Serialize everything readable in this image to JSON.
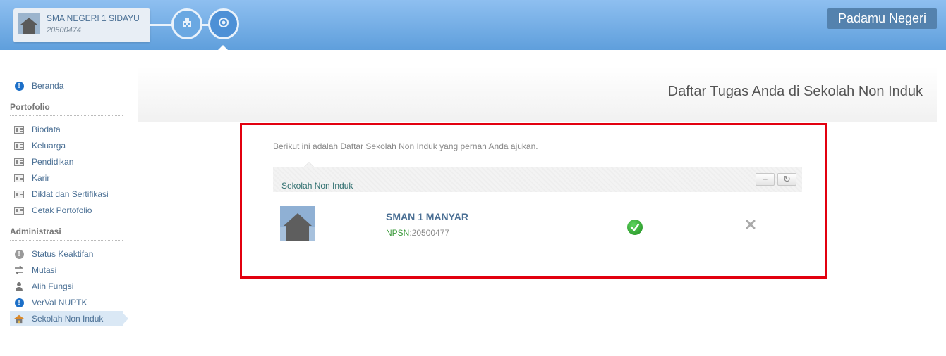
{
  "header": {
    "school_name": "SMA NEGERI 1 SIDAYU",
    "school_code": "20500474",
    "brand": "Padamu Negeri",
    "steps": [
      {
        "icon": "building-icon"
      },
      {
        "icon": "emblem-icon"
      }
    ]
  },
  "sidebar": {
    "beranda": {
      "label": "Beranda",
      "icon": "info-icon"
    },
    "portofolio_title": "Portofolio",
    "portofolio_items": [
      {
        "label": "Biodata",
        "icon": "id-card-icon"
      },
      {
        "label": "Keluarga",
        "icon": "id-card-icon"
      },
      {
        "label": "Pendidikan",
        "icon": "id-card-icon"
      },
      {
        "label": "Karir",
        "icon": "id-card-icon"
      },
      {
        "label": "Diklat dan Sertifikasi",
        "icon": "id-card-icon"
      },
      {
        "label": "Cetak Portofolio",
        "icon": "id-card-icon"
      }
    ],
    "administrasi_title": "Administrasi",
    "administrasi_items": [
      {
        "label": "Status Keaktifan",
        "icon": "info-grey-icon"
      },
      {
        "label": "Mutasi",
        "icon": "transfer-icon"
      },
      {
        "label": "Alih Fungsi",
        "icon": "person-icon"
      },
      {
        "label": "VerVal NUPTK",
        "icon": "info-icon"
      },
      {
        "label": "Sekolah Non Induk",
        "icon": "school-house-icon",
        "active": true
      }
    ]
  },
  "main": {
    "title": "Daftar Tugas Anda di Sekolah Non Induk",
    "intro": "Berikut ini adalah Daftar Sekolah Non Induk yang pernah Anda ajukan.",
    "list_title": "Sekolah Non Induk",
    "tools": {
      "add": "+",
      "refresh": "↻"
    },
    "rows": [
      {
        "name": "SMAN 1 MANYAR",
        "npsn_label": "NPSN",
        "npsn_value": ":20500477",
        "status": "approved"
      }
    ]
  },
  "colors": {
    "header_top": "#8ebff0",
    "header_bottom": "#5f9fdc",
    "link": "#4a6f94",
    "highlight_border": "#e2000f",
    "active_nav": "#dae8f5"
  }
}
